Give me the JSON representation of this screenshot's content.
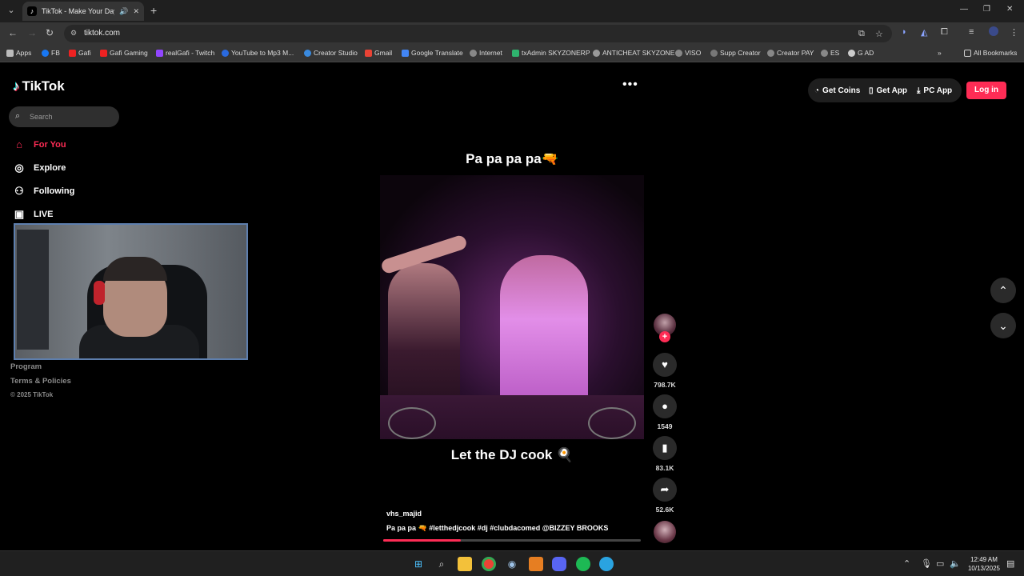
{
  "browser": {
    "tab_title": "TikTok - Make Your Day",
    "url": "tiktok.com",
    "bookmarks": [
      "Apps",
      "FB",
      "Gafi",
      "Gafi Gaming",
      "realGafi - Twitch",
      "YouTube to Mp3 M...",
      "Creator Studio",
      "Gmail",
      "Google Translate",
      "Internet",
      "txAdmin SKYZONERP",
      "ANTICHEAT SKYZONE",
      "VISO",
      "Supp Creator",
      "Creator PAY",
      "ES",
      "G AD"
    ],
    "all_bookmarks": "All Bookmarks"
  },
  "tiktok": {
    "logo": "TikTok",
    "search_placeholder": "Search",
    "nav": [
      {
        "label": "For You",
        "icon": "home-icon",
        "active": true
      },
      {
        "label": "Explore",
        "icon": "compass-icon"
      },
      {
        "label": "Following",
        "icon": "following-icon"
      },
      {
        "label": "LIVE",
        "icon": "live-icon"
      }
    ],
    "footer_links": [
      "Program",
      "Terms & Policies"
    ],
    "copyright": "© 2025 TikTok",
    "top_buttons": {
      "get_coins": "Get Coins",
      "get_app": "Get App",
      "pc_app": "PC App",
      "login": "Log in"
    }
  },
  "video": {
    "caption_top": "Pa pa pa pa🔫",
    "caption_bottom": "Let the DJ cook 🍳",
    "author": "vhs_majid",
    "description": "Pa pa pa 🔫 #letthedjcook #dj #clubdacomed  @BIZZEY BROOKS",
    "progress": 0.3,
    "likes": "798.7K",
    "comments": "1549",
    "saves": "83.1K",
    "shares": "52.6K"
  },
  "taskbar": {
    "time": "12:49 AM",
    "date": "10/13/2025"
  },
  "colors": {
    "accent": "#fe2c55",
    "page_bg": "#000000",
    "chrome_bg": "#353535"
  }
}
